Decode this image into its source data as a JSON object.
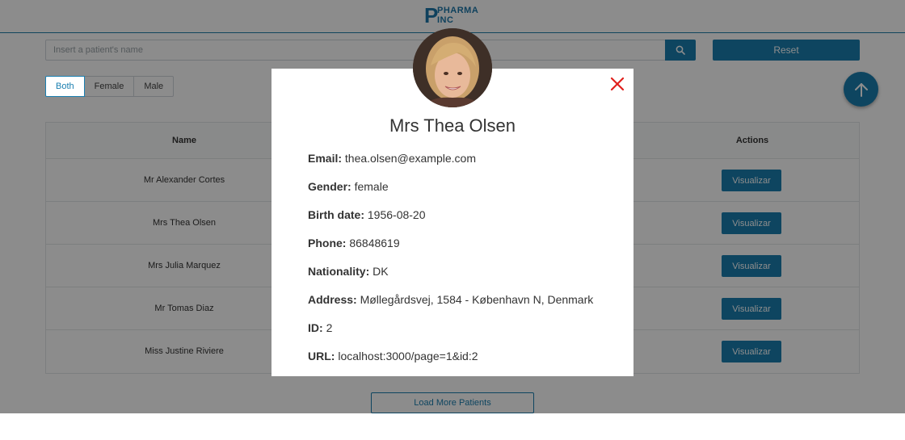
{
  "brand": {
    "logo_letter": "P",
    "logo_line1": "PHARMA",
    "logo_line2": "INC"
  },
  "search": {
    "placeholder": "Insert a patient's name",
    "value": "",
    "reset_label": "Reset"
  },
  "filters": [
    {
      "label": "Both",
      "active": true
    },
    {
      "label": "Female",
      "active": false
    },
    {
      "label": "Male",
      "active": false
    }
  ],
  "table": {
    "columns": {
      "name": "Name",
      "actions": "Actions"
    },
    "rows": [
      {
        "name": "Mr Alexander Cortes",
        "action": "Visualizar"
      },
      {
        "name": "Mrs Thea Olsen",
        "action": "Visualizar"
      },
      {
        "name": "Mrs Julia Marquez",
        "action": "Visualizar"
      },
      {
        "name": "Mr Tomas Diaz",
        "action": "Visualizar"
      },
      {
        "name": "Miss Justine Riviere",
        "action": "Visualizar"
      }
    ]
  },
  "load_more_label": "Load More Patients",
  "modal": {
    "title": "Mrs Thea Olsen",
    "fields": [
      {
        "label": "Email:",
        "value": "thea.olsen@example.com"
      },
      {
        "label": "Gender:",
        "value": "female"
      },
      {
        "label": "Birth date:",
        "value": "1956-08-20"
      },
      {
        "label": "Phone:",
        "value": "86848619"
      },
      {
        "label": "Nationality:",
        "value": "DK"
      },
      {
        "label": "Address:",
        "value": "Møllegårdsvej, 1584 - København N, Denmark"
      },
      {
        "label": "ID:",
        "value": "2"
      },
      {
        "label": "URL:",
        "value": "localhost:3000/page=1&id:2"
      }
    ]
  },
  "icons": {
    "search": "search-icon",
    "scroll_top": "arrow-up-icon",
    "close": "close-icon",
    "avatar": "patient-avatar"
  },
  "colors": {
    "primary": "#1a7fb0",
    "close": "#e0201c",
    "overlay": "rgba(0,0,0,0.45)"
  }
}
